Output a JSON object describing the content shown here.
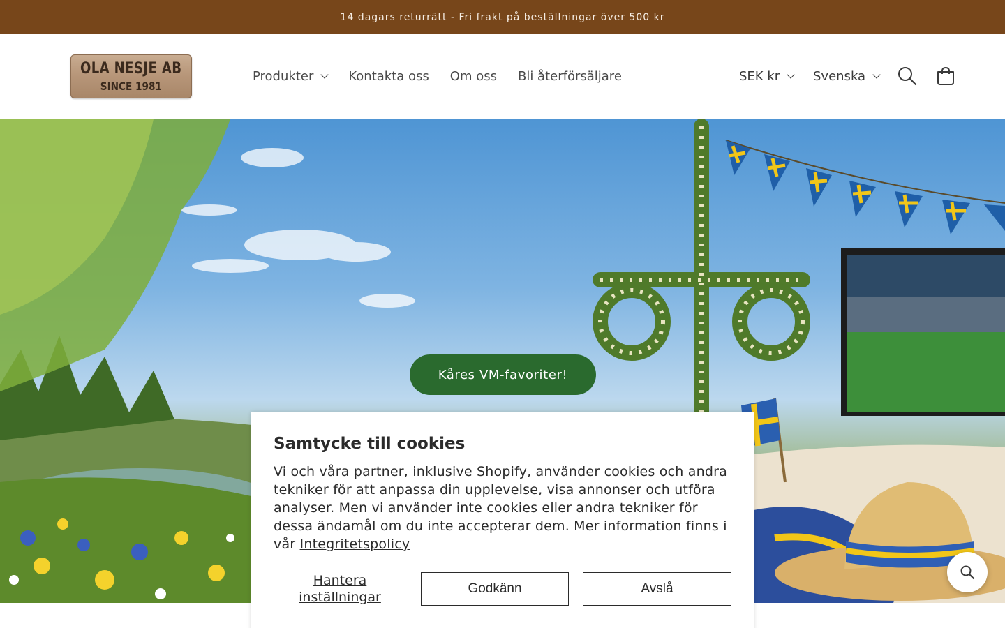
{
  "announcement": {
    "text": "14 dagars returrätt - Fri frakt på beställningar över 500 kr"
  },
  "header": {
    "logo": {
      "line1": "OLA NESJE AB",
      "line2": "SINCE 1981"
    },
    "nav": [
      {
        "label": "Produkter",
        "has_dropdown": true
      },
      {
        "label": "Kontakta oss"
      },
      {
        "label": "Om oss"
      },
      {
        "label": "Bli återförsäljare"
      }
    ],
    "currency_selector": "SEK kr",
    "language_selector": "Svenska",
    "icons": [
      "search-icon",
      "cart-icon",
      "chevron-down-icon"
    ]
  },
  "hero": {
    "button_label": "Kåres VM-favoriter!"
  },
  "cookie_banner": {
    "title": "Samtycke till cookies",
    "body": "Vi och våra partner, inklusive Shopify, använder cookies och andra tekniker för att anpassa din upplevelse, visa annonser och utföra analyser. Men vi använder inte cookies eller andra tekniker för dessa ändamål om du inte accepterar dem. Mer information finns i vår ",
    "policy_link": "Integritetspolicy",
    "manage_label": "Hantera inställningar",
    "accept_label": "Godkänn",
    "decline_label": "Avslå"
  },
  "colors": {
    "announcement_bg": "#77461a",
    "hero_button_bg": "#2a6a2e",
    "text": "#3a3a3a"
  }
}
